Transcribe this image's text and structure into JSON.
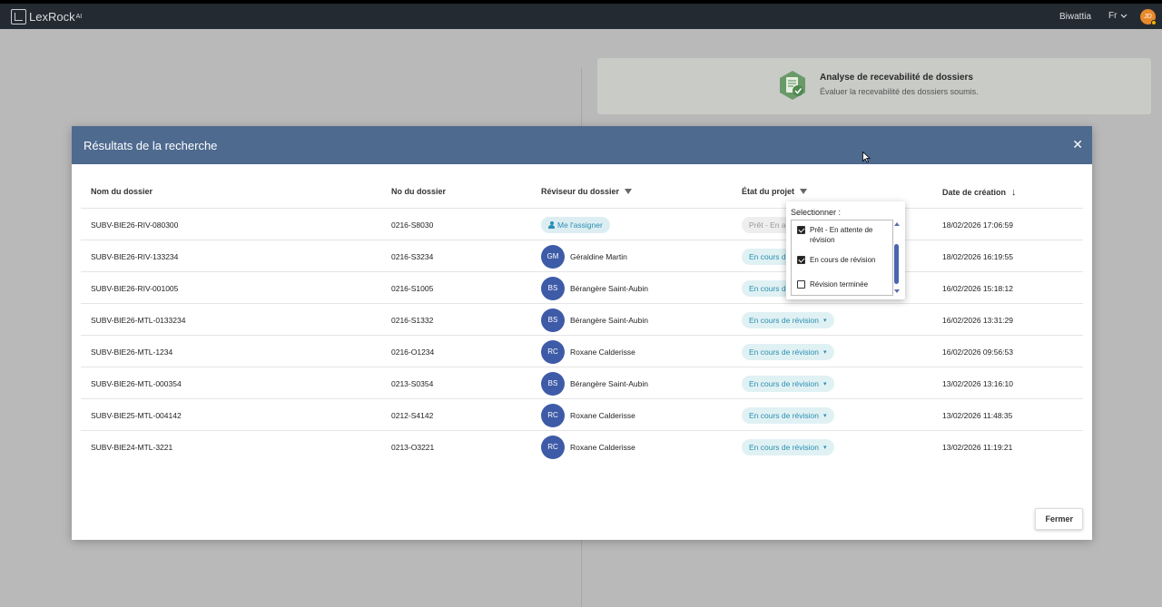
{
  "topbar": {
    "app_name": "LexRock",
    "app_suffix": "AI",
    "user_name": "Biwattia",
    "language": "Fr",
    "user_initials": "JD"
  },
  "background_card": {
    "title": "Analyse de recevabilité de dossiers",
    "subtitle": "Évaluer la recevabilité des dossiers soumis."
  },
  "modal": {
    "title": "Résultats de la recherche",
    "close_icon": "close-icon",
    "close_button_label": "Fermer",
    "columns": {
      "name": "Nom du dossier",
      "number": "No du dossier",
      "reviewer": "Réviseur du dossier",
      "status": "État du projet",
      "date": "Date de création"
    },
    "assign_label": "Me l'assigner",
    "rows": [
      {
        "name": "SUBV-BIE26-RIV-080300",
        "number": "0216-S8030",
        "reviewer_initials": "",
        "reviewer": "",
        "status": "Prêt - En a",
        "date": "18/02/2026 17:06:59"
      },
      {
        "name": "SUBV-BIE26-RIV-133234",
        "number": "0216-S3234",
        "reviewer_initials": "GM",
        "reviewer": "Géraldine Martin",
        "status": "En cours d",
        "date": "18/02/2026 16:19:55"
      },
      {
        "name": "SUBV-BIE26-RIV-001005",
        "number": "0216-S1005",
        "reviewer_initials": "BS",
        "reviewer": "Bérangère Saint-Aubin",
        "status": "En cours d",
        "date": "16/02/2026 15:18:12"
      },
      {
        "name": "SUBV-BIE26-MTL-0133234",
        "number": "0216-S1332",
        "reviewer_initials": "BS",
        "reviewer": "Bérangère Saint-Aubin",
        "status": "En cours de révision",
        "date": "16/02/2026 13:31:29"
      },
      {
        "name": "SUBV-BIE26-MTL-1234",
        "number": "0216-O1234",
        "reviewer_initials": "RC",
        "reviewer": "Roxane Calderisse",
        "status": "En cours de révision",
        "date": "16/02/2026 09:56:53"
      },
      {
        "name": "SUBV-BIE26-MTL-000354",
        "number": "0213-S0354",
        "reviewer_initials": "BS",
        "reviewer": "Bérangère Saint-Aubin",
        "status": "En cours de révision",
        "date": "13/02/2026 13:16:10"
      },
      {
        "name": "SUBV-BIE25-MTL-004142",
        "number": "0212-S4142",
        "reviewer_initials": "RC",
        "reviewer": "Roxane Calderisse",
        "status": "En cours de révision",
        "date": "13/02/2026 11:48:35"
      },
      {
        "name": "SUBV-BIE24-MTL-3221",
        "number": "0213-O3221",
        "reviewer_initials": "RC",
        "reviewer": "Roxane Calderisse",
        "status": "En cours de révision",
        "date": "13/02/2026 11:19:21"
      }
    ]
  },
  "status_filter": {
    "label": "Selectionner :",
    "options": [
      {
        "label": "Prêt - En attente de révision",
        "checked": true
      },
      {
        "label": "En cours de révision",
        "checked": true
      },
      {
        "label": "Révision terminée",
        "checked": false
      }
    ]
  },
  "colors": {
    "modal_header": "#4e6a8f",
    "avatar": "#3e5ba7",
    "chip_text": "#2b8fb0",
    "chip_bg": "#e0f1f4"
  }
}
